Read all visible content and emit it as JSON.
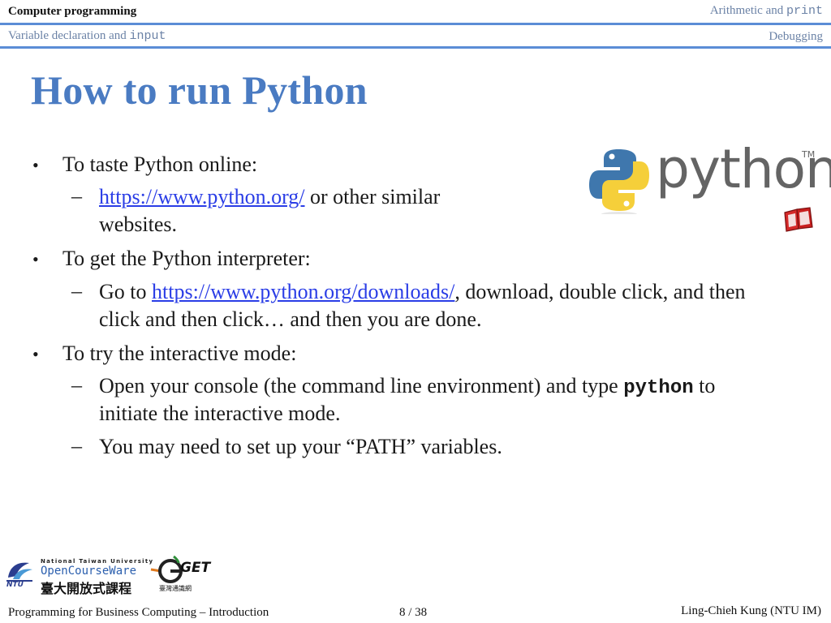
{
  "nav": {
    "row1_left": "Computer programming",
    "row1_right_text": "Arithmetic and ",
    "row1_right_code": "print",
    "row2_left_text": "Variable declaration and ",
    "row2_left_code": "input",
    "row2_right": "Debugging"
  },
  "slide": {
    "title": "How to run Python",
    "b1": "To taste Python online:",
    "b1_sub_link": "https://www.python.org/",
    "b1_sub_rest": " or other similar",
    "b1_sub_line2": "websites.",
    "b2": "To get the Python interpreter:",
    "b2_sub_pre": "Go to ",
    "b2_sub_link": "https://www.python.org/downloads/",
    "b2_sub_rest": ", download, double click, and then",
    "b2_sub_line2": "click and then click… and then you are done.",
    "b3": "To try the interactive mode:",
    "b3_sub1_pre": "Open your console (the command line environment) and type ",
    "b3_sub1_cmd": "python",
    "b3_sub1_post": " to",
    "b3_sub1_line2": "initiate the interactive mode.",
    "b3_sub2": "You may need to set up your “PATH” variables.",
    "bullet_char": "•",
    "dash_char": "–"
  },
  "logo": {
    "python_word": "python",
    "tm": "TM"
  },
  "ocw": {
    "line1": "National Taiwan University",
    "line2": "OpenCourseWare",
    "line3": "臺大開放式課程",
    "ntu": "NTU"
  },
  "get": {
    "word": "GET",
    "sub": "臺灣通識網"
  },
  "footer": {
    "left": "Programming for Business Computing – Introduction",
    "page": "8 / 38",
    "right": "Ling-Chieh Kung (NTU IM)"
  },
  "colors": {
    "accent": "#5b8dd6",
    "title": "#4a7bc2",
    "link": "#2a3de6"
  }
}
